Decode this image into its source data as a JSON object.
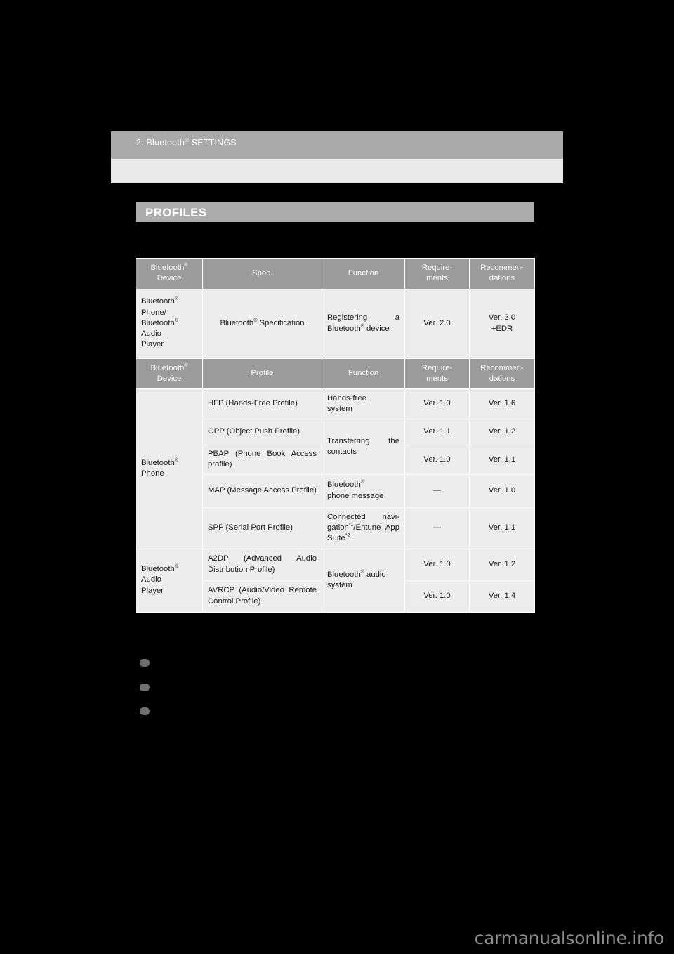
{
  "page": {
    "background_color": "#000000",
    "content_background": "#ededed",
    "accent_gray": "#aaaaaa",
    "header_gray": "#9b9b9b"
  },
  "header": {
    "chapter_text": "2. Bluetooth® SETTINGS",
    "chapter_number": "2.",
    "chapter_name_pre": "Bluetooth",
    "chapter_reg": "®",
    "chapter_name_post": " SETTINGS"
  },
  "section": {
    "title": "PROFILES"
  },
  "table": {
    "header_row_1": {
      "device": "Bluetooth® Device",
      "device_pre": "Bluetooth",
      "device_reg": "®",
      "device_post": "Device",
      "spec": "Spec.",
      "function": "Function",
      "requirements": "Require-ments",
      "requirements_line1": "Require-",
      "requirements_line2": "ments",
      "recommendations": "Recommen-dations",
      "recommendations_line1": "Recommen-",
      "recommendations_line2": "dations"
    },
    "spec_row": {
      "device_lines": "Bluetooth® Phone/ Bluetooth® Audio Player",
      "device_l1_pre": "Bluetooth",
      "device_l1_reg": "®",
      "device_l2": "Phone/",
      "device_l3_pre": "Bluetooth",
      "device_l3_reg": "®",
      "device_l4": "Audio",
      "device_l5": "Player",
      "spec_pre": "Bluetooth",
      "spec_reg": "®",
      "spec_post": " Specification",
      "function_pre": "Registering a ",
      "function_mid": "Bluetooth",
      "function_reg": "®",
      "function_post": " device",
      "requirements": "Ver. 2.0",
      "recommendations_line1": "Ver. 3.0",
      "recommendations_line2": "+EDR"
    },
    "header_row_2": {
      "device_pre": "Bluetooth",
      "device_reg": "®",
      "device_post": "Device",
      "profile": "Profile",
      "function": "Function",
      "requirements_line1": "Require-",
      "requirements_line2": "ments",
      "recommendations_line1": "Recommen-",
      "recommendations_line2": "dations"
    },
    "device_groups": [
      {
        "label_pre": "Bluetooth",
        "label_reg": "®",
        "label_post": "Phone"
      },
      {
        "label_pre": "Bluetooth",
        "label_reg": "®",
        "label_l2": "Audio",
        "label_l3": "Player"
      }
    ],
    "rows": [
      {
        "profile": "HFP (Hands-Free Profile)",
        "function_l1": "Hands-free",
        "function_l2": "system",
        "requirements": "Ver. 1.0",
        "recommendations": "Ver. 1.6"
      },
      {
        "profile": "OPP (Object Push Profile)",
        "requirements": "Ver. 1.1",
        "recommendations": "Ver. 1.2"
      },
      {
        "profile": "PBAP (Phone Book Access profile)",
        "requirements": "Ver. 1.0",
        "recommendations": "Ver. 1.1"
      },
      {
        "profile": "MAP (Message Access Profile)",
        "requirements": "—",
        "recommendations": "Ver. 1.0"
      },
      {
        "profile": "SPP (Serial Port Profile)",
        "requirements": "—",
        "recommendations": "Ver. 1.1"
      },
      {
        "profile": "A2DP (Advanced Audio Distribution Profile)",
        "requirements": "Ver. 1.0",
        "recommendations": "Ver. 1.2"
      },
      {
        "profile": "AVRCP (Audio/Video Remote Control Profile)",
        "requirements": "Ver. 1.0",
        "recommendations": "Ver. 1.4"
      }
    ],
    "merged_functions": {
      "transferring": "Transferring the contacts",
      "phone_message_pre": "Bluetooth",
      "phone_message_reg": "®",
      "phone_message_post": "phone message",
      "connected_nav_pre": "Connected navi-gation",
      "connected_nav_fn1": "*1",
      "connected_nav_mid": "/Entune App Suite",
      "connected_nav_fn2": "*2",
      "audio_system_pre": "Bluetooth",
      "audio_system_reg": "®",
      "audio_system_post": " audio system"
    }
  },
  "footer": {
    "watermark": "carmanualsonline.info"
  }
}
